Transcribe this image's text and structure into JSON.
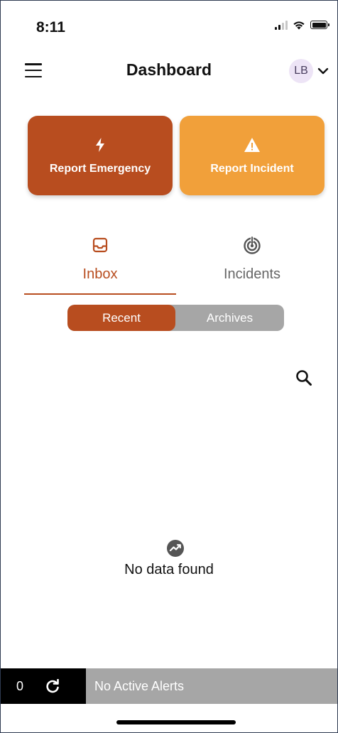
{
  "status_bar": {
    "time": "8:11"
  },
  "header": {
    "title": "Dashboard",
    "avatar_initials": "LB"
  },
  "actions": {
    "emergency_label": "Report Emergency",
    "incident_label": "Report Incident",
    "emergency_color": "#b84d1f",
    "incident_color": "#f1a03a"
  },
  "tabs": [
    {
      "label": "Inbox",
      "icon": "inbox-icon",
      "active": true
    },
    {
      "label": "Incidents",
      "icon": "target-icon",
      "active": false
    }
  ],
  "segments": [
    {
      "label": "Recent",
      "active": true
    },
    {
      "label": "Archives",
      "active": false
    }
  ],
  "empty_state": {
    "message": "No data found",
    "icon": "trend-chart-icon"
  },
  "alert_bar": {
    "count": "0",
    "status": "No Active Alerts"
  },
  "colors": {
    "accent": "#b84d1f",
    "inactive_text": "#666666",
    "segment_bg": "#a6a6a6"
  }
}
